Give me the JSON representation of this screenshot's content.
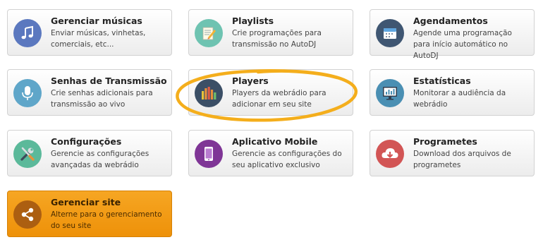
{
  "cards": [
    {
      "title": "Gerenciar músicas",
      "desc": "Enviar músicas, vinhetas, comerciais, etc...",
      "icon": "music-note-icon",
      "color": "#5b78bf"
    },
    {
      "title": "Playlists",
      "desc": "Crie programações para transmissão no AutoDJ",
      "icon": "playlist-edit-icon",
      "color": "#6ec3b1"
    },
    {
      "title": "Agendamentos",
      "desc": "Agende uma programação para início automático no AutoDJ",
      "icon": "calendar-icon",
      "color": "#3f5672"
    },
    {
      "title": "Senhas de Transmissão",
      "desc": "Crie senhas adicionais para transmissão ao vivo",
      "icon": "microphone-icon",
      "color": "#5fa6c9"
    },
    {
      "title": "Players",
      "desc": "Players da webrádio para adicionar em seu site",
      "icon": "equalizer-icon",
      "color": "#3b4f66"
    },
    {
      "title": "Estatísticas",
      "desc": "Monitorar a audiência da webrádio",
      "icon": "monitor-chart-icon",
      "color": "#4a8fb3"
    },
    {
      "title": "Configurações",
      "desc": "Gerencie as configurações avançadas da webrádio",
      "icon": "tools-icon",
      "color": "#5bb99a"
    },
    {
      "title": "Aplicativo Mobile",
      "desc": "Gerencie as configurações do seu aplicativo exclusivo",
      "icon": "smartphone-icon",
      "color": "#7f3596"
    },
    {
      "title": "Programetes",
      "desc": "Download dos arquivos de programetes",
      "icon": "cloud-download-icon",
      "color": "#d25555"
    },
    {
      "title": "Gerenciar site",
      "desc": "Alterne para o gerenciamento do seu site",
      "icon": "share-icon",
      "color": "#ac5f11"
    }
  ],
  "highlight_color": "#f4ae1c"
}
